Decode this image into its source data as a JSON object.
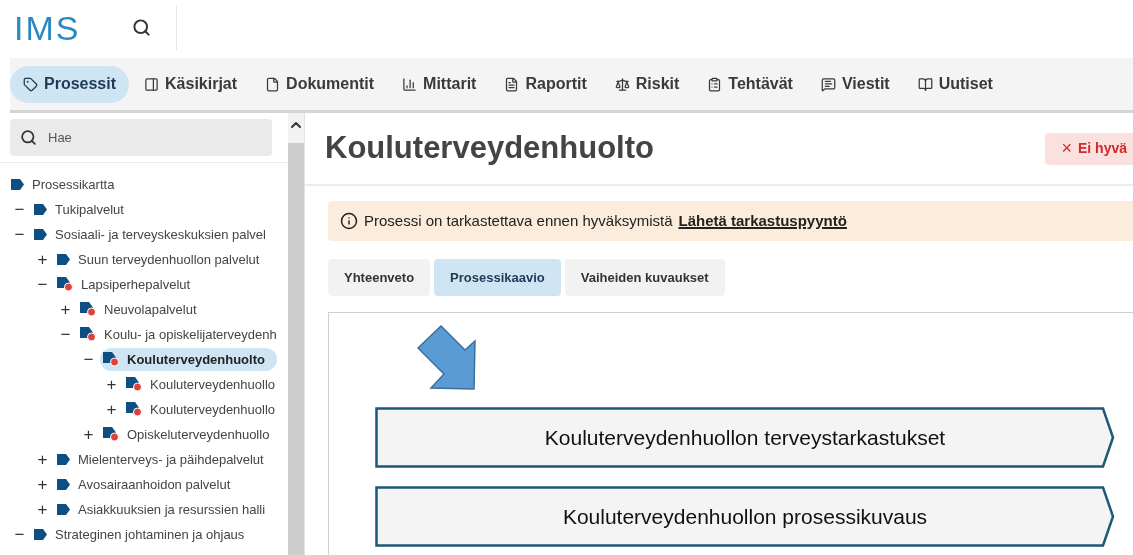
{
  "header": {
    "logo": "IMS"
  },
  "nav": [
    {
      "label": "Prosessit",
      "selected": true
    },
    {
      "label": "Käsikirjat",
      "selected": false
    },
    {
      "label": "Dokumentit",
      "selected": false
    },
    {
      "label": "Mittarit",
      "selected": false
    },
    {
      "label": "Raportit",
      "selected": false
    },
    {
      "label": "Riskit",
      "selected": false
    },
    {
      "label": "Tehtävät",
      "selected": false
    },
    {
      "label": "Viestit",
      "selected": false
    },
    {
      "label": "Uutiset",
      "selected": false
    }
  ],
  "sidebar": {
    "search": {
      "placeholder": "Hae"
    },
    "tree": [
      {
        "label": "Prosessikartta",
        "selected": false,
        "flagged": false,
        "children": [
          {
            "label": "Tukipalvelut",
            "toggle": "−",
            "selected": false,
            "flagged": false
          },
          {
            "label": "Sosiaali- ja terveyskeskuksien palvel",
            "toggle": "−",
            "selected": false,
            "flagged": false,
            "children": [
              {
                "label": "Suun terveydenhuollon palvelut",
                "toggle": "+",
                "selected": false,
                "flagged": false
              },
              {
                "label": "Lapsiperhepalvelut",
                "toggle": "−",
                "selected": false,
                "flagged": true,
                "children": [
                  {
                    "label": "Neuvolapalvelut",
                    "toggle": "+",
                    "selected": false,
                    "flagged": true
                  },
                  {
                    "label": "Koulu- ja opiskelijaterveydenh",
                    "toggle": "−",
                    "selected": false,
                    "flagged": true,
                    "children": [
                      {
                        "label": "Kouluterveydenhuolto",
                        "toggle": "−",
                        "selected": true,
                        "flagged": true,
                        "children": [
                          {
                            "label": "Kouluterveydenhuollo",
                            "toggle": "+",
                            "selected": false,
                            "flagged": true
                          },
                          {
                            "label": "Kouluterveydenhuollo",
                            "toggle": "+",
                            "selected": false,
                            "flagged": true
                          }
                        ]
                      },
                      {
                        "label": "Opiskeluterveydenhuollo",
                        "toggle": "+",
                        "selected": false,
                        "flagged": true
                      }
                    ]
                  }
                ]
              },
              {
                "label": "Mielenterveys- ja päihdepalvelut",
                "toggle": "+",
                "selected": false,
                "flagged": false
              },
              {
                "label": "Avosairaanhoidon palvelut",
                "toggle": "+",
                "selected": false,
                "flagged": false
              },
              {
                "label": "Asiakkuuksien ja resurssien halli",
                "toggle": "+",
                "selected": false,
                "flagged": false
              }
            ]
          },
          {
            "label": "Strateginen johtaminen ja ohjaus",
            "toggle": "−",
            "selected": false,
            "flagged": false
          }
        ]
      }
    ]
  },
  "main": {
    "title": "Kouluterveydenhuolto",
    "status_button": {
      "icon": "×",
      "label": "Ei hyvä"
    },
    "notice": {
      "text": "Prosessi on tarkastettava ennen hyväksymistä",
      "link": "Lähetä tarkastuspyyntö"
    },
    "tabs": [
      {
        "label": "Yhteenveto",
        "selected": false
      },
      {
        "label": "Prosessikaavio",
        "selected": true
      },
      {
        "label": "Vaiheiden kuvaukset",
        "selected": false
      }
    ],
    "diagram": {
      "steps": [
        {
          "label": "Kouluterveydenhuollon terveystarkastukset"
        },
        {
          "label": "Kouluterveydenhuollon prosessikuvaus"
        }
      ]
    }
  }
}
